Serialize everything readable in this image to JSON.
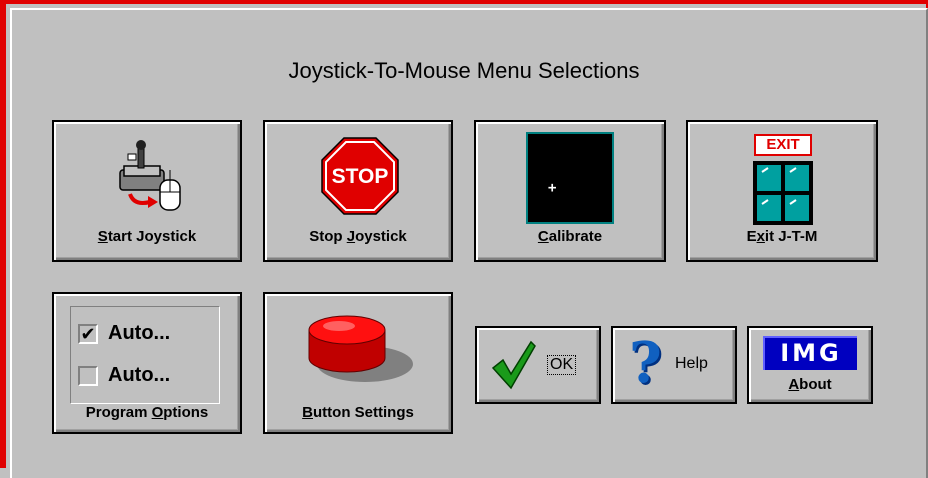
{
  "window": {
    "title": "Joystick-To-Mouse Menu Selections"
  },
  "buttons": {
    "start": {
      "label_pre": "",
      "label_ul": "S",
      "label_post": "tart Joystick"
    },
    "stop": {
      "label_pre": "Stop ",
      "label_ul": "J",
      "label_post": "oystick",
      "sign_text": "STOP"
    },
    "calibrate": {
      "label_pre": "",
      "label_ul": "C",
      "label_post": "alibrate",
      "crosshair": "+"
    },
    "exit": {
      "label_pre": "E",
      "label_ul": "x",
      "label_post": "it J-T-M",
      "sign_text": "EXIT"
    },
    "program_options": {
      "label_pre": "Program ",
      "label_ul": "O",
      "label_post": "ptions",
      "options": [
        {
          "text": "Auto...",
          "checked": true,
          "mark": "✔"
        },
        {
          "text": "Auto...",
          "checked": false,
          "mark": ""
        }
      ]
    },
    "button_settings": {
      "label_pre": "",
      "label_ul": "B",
      "label_post": "utton Settings"
    },
    "ok": {
      "label": "OK"
    },
    "help": {
      "label": "Help",
      "glyph": "?"
    },
    "about": {
      "label_pre": "",
      "label_ul": "A",
      "label_post": "bout",
      "logo_text": "IMG"
    }
  },
  "colors": {
    "accent_red": "#e00000",
    "face": "#c0c0c0",
    "ok_green": "#1a9a1a",
    "help_blue": "#1060c0",
    "img_blue": "#0000c0"
  }
}
